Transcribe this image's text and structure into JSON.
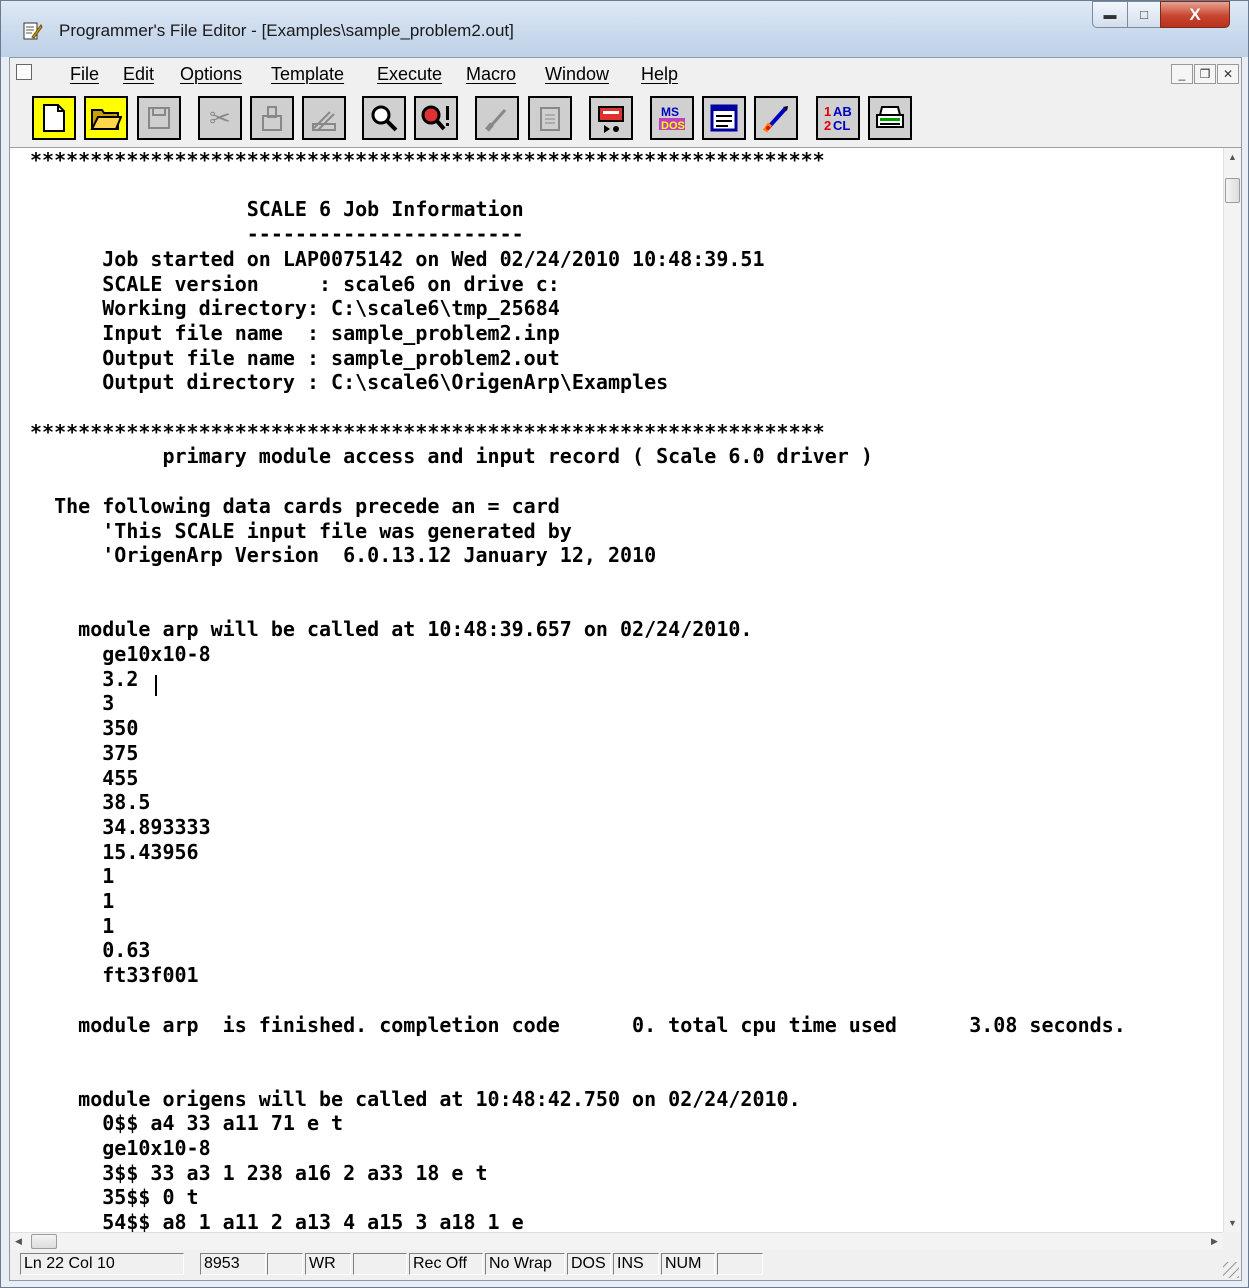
{
  "window": {
    "title": "Programmer's File Editor - [Examples\\sample_problem2.out]"
  },
  "menu": [
    {
      "label": "File"
    },
    {
      "label": "Edit"
    },
    {
      "label": "Options"
    },
    {
      "label": "Template"
    },
    {
      "label": "Execute"
    },
    {
      "label": "Macro"
    },
    {
      "label": "Window"
    },
    {
      "label": "Help"
    }
  ],
  "toolbar_icons": [
    "new-file-icon",
    "open-folder-icon",
    "save-icon",
    "cut-icon",
    "copy-icon",
    "paste-icon",
    "find-icon",
    "find-next-icon",
    "undo-icon",
    "clipboard-icon",
    "tape-icon",
    "ms-dos-icon",
    "window-list-icon",
    "rocket-icon",
    "1ab-2cl-icon",
    "print-icon"
  ],
  "editor": {
    "lines": [
      "******************************************************************",
      "",
      "                  SCALE 6 Job Information",
      "                  -----------------------",
      "      Job started on LAP0075142 on Wed 02/24/2010 10:48:39.51",
      "      SCALE version     : scale6 on drive c:",
      "      Working directory: C:\\scale6\\tmp_25684",
      "      Input file name  : sample_problem2.inp",
      "      Output file name : sample_problem2.out",
      "      Output directory : C:\\scale6\\OrigenArp\\Examples",
      "",
      "******************************************************************",
      "           primary module access and input record ( Scale 6.0 driver )",
      "",
      "  The following data cards precede an = card",
      "      'This SCALE input file was generated by",
      "      'OrigenArp Version  6.0.13.12 January 12, 2010",
      "",
      "",
      "    module arp will be called at 10:48:39.657 on 02/24/2010.",
      "      ge10x10-8",
      "      3.2",
      "      3",
      "      350",
      "      375",
      "      455",
      "      38.5",
      "      34.893333",
      "      15.43956",
      "      1",
      "      1",
      "      1",
      "      0.63",
      "      ft33f001",
      "",
      "    module arp  is finished. completion code      0. total cpu time used      3.08 seconds.",
      "",
      "",
      "    module origens will be called at 10:48:42.750 on 02/24/2010.",
      "      0$$ a4 33 a11 71 e t",
      "      ge10x10-8",
      "      3$$ 33 a3 1 238 a16 2 a33 18 e t",
      "      35$$ 0 t",
      "      54$$ a8 1 a11 2 a13 4 a15 3 a18 1 e"
    ]
  },
  "status": {
    "position": "Ln 22 Col 10",
    "size": "8953",
    "blank1": "",
    "mode": "WR",
    "blank2": "",
    "rec": "Rec Off",
    "wrap": "No Wrap",
    "dos": "DOS",
    "ins": "INS",
    "num": "NUM",
    "blank3": ""
  }
}
